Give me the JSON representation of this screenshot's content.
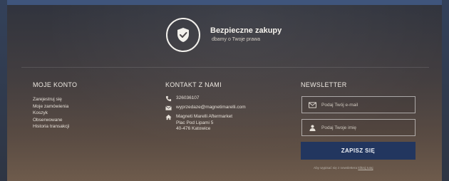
{
  "secure": {
    "title": "Bezpieczne zakupy",
    "subtitle": "dbamy o Twoje prawa",
    "icon": "shield-check-icon"
  },
  "account": {
    "title": "MOJE KONTO",
    "links": [
      "Zarejestruj się",
      "Moje zamówienia",
      "Koszyk",
      "Obserwowane",
      "Historia transakcji"
    ]
  },
  "contact": {
    "title": "KONTAKT Z NAMI",
    "phone": "326036107",
    "email": "wyprzedaze@magnetimarelli.com",
    "address": [
      "Magneti Marelli Aftermarket",
      "Plac Pod Lipami 5",
      "40-476 Katowice"
    ],
    "icons": [
      "phone-icon",
      "envelope-icon",
      "home-icon"
    ]
  },
  "newsletter": {
    "title": "NEWSLETTER",
    "email_placeholder": "Podaj Twój e-mail",
    "email_value": "",
    "name_placeholder": "Podaj Twoje imię",
    "name_value": "",
    "submit_label": "ZAPISZ SIĘ",
    "note_text": "Aby wypisać się z newslettera",
    "note_link": "kliknij tutaj"
  },
  "colors": {
    "button": "#22365f",
    "topbar": "#3f557c"
  }
}
